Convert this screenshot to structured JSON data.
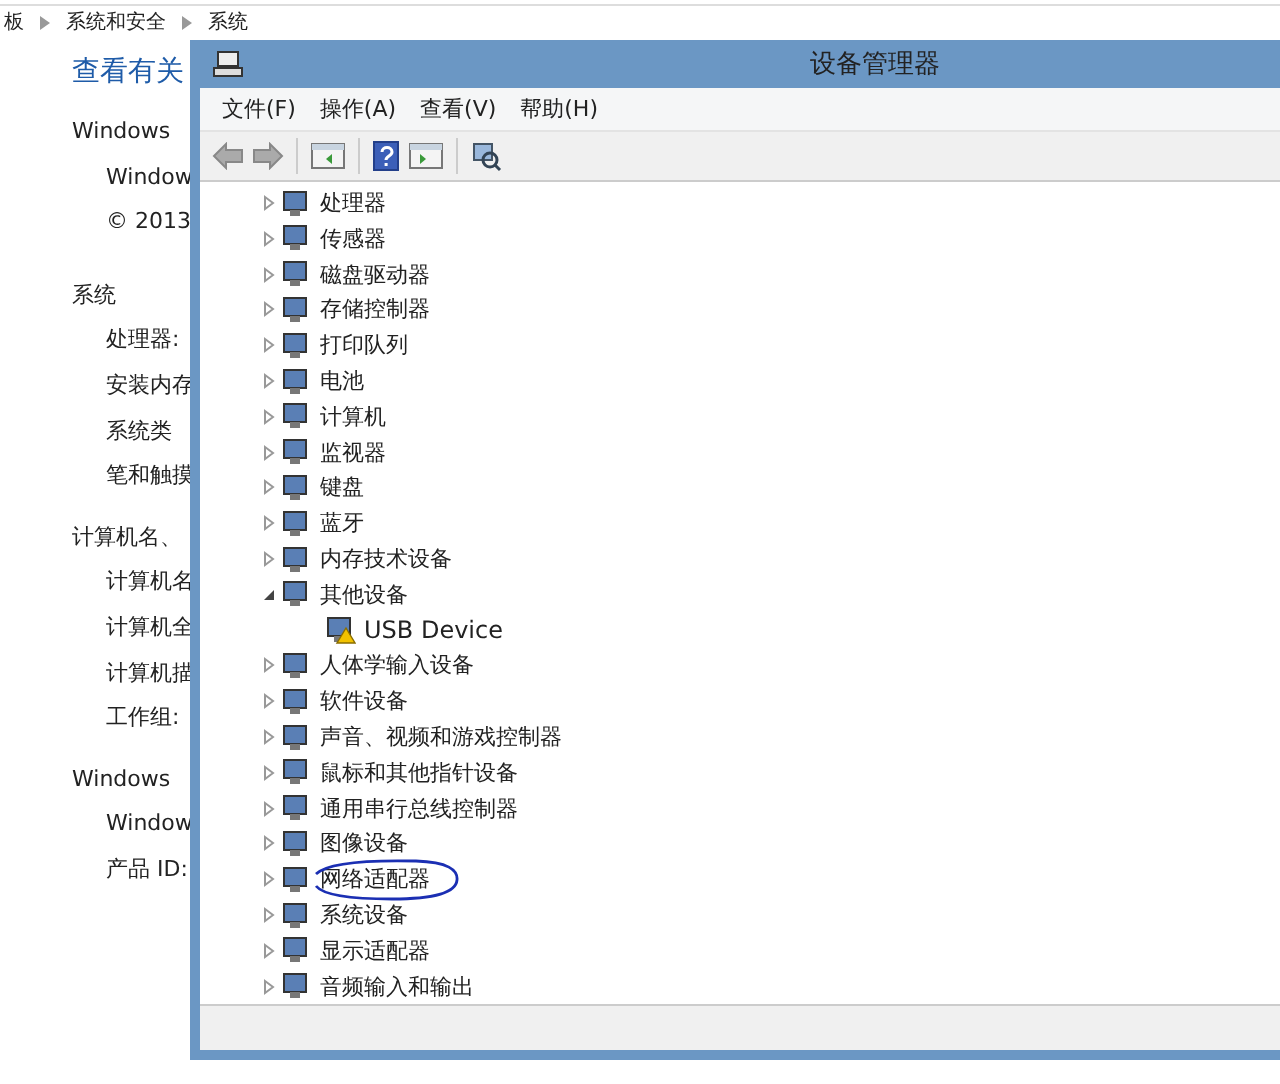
{
  "background_page": {
    "breadcrumb": [
      "板",
      "系统和安全",
      "系统"
    ],
    "heading": "查看有关",
    "lines": [
      {
        "text": "Windows",
        "kind": "section"
      },
      {
        "text": "Window",
        "kind": "item"
      },
      {
        "text": "© 2013",
        "kind": "item"
      },
      {
        "text": "系统",
        "kind": "group"
      },
      {
        "text": "处理器:",
        "kind": "item"
      },
      {
        "text": "安装内存",
        "kind": "item"
      },
      {
        "text": "系统类",
        "kind": "item"
      },
      {
        "text": "笔和触摸",
        "kind": "item"
      },
      {
        "text": "计算机名、",
        "kind": "section"
      },
      {
        "text": "计算机名",
        "kind": "item"
      },
      {
        "text": "计算机全",
        "kind": "item"
      },
      {
        "text": "计算机描",
        "kind": "item"
      },
      {
        "text": "工作组:",
        "kind": "item"
      },
      {
        "text": "Windows",
        "kind": "section"
      },
      {
        "text": "Window",
        "kind": "item"
      },
      {
        "text": "产品 ID:",
        "kind": "item"
      }
    ]
  },
  "window": {
    "title": "设备管理器",
    "menu": [
      "文件(F)",
      "操作(A)",
      "查看(V)",
      "帮助(H)"
    ],
    "tree": [
      {
        "label": "处理器",
        "expanded": false,
        "circled": false
      },
      {
        "label": "传感器",
        "expanded": false,
        "circled": false
      },
      {
        "label": "磁盘驱动器",
        "expanded": false,
        "circled": false
      },
      {
        "label": "存储控制器",
        "expanded": false,
        "circled": false
      },
      {
        "label": "打印队列",
        "expanded": false,
        "circled": false
      },
      {
        "label": "电池",
        "expanded": false,
        "circled": false
      },
      {
        "label": "计算机",
        "expanded": false,
        "circled": false
      },
      {
        "label": "监视器",
        "expanded": false,
        "circled": false
      },
      {
        "label": "键盘",
        "expanded": false,
        "circled": false
      },
      {
        "label": "蓝牙",
        "expanded": false,
        "circled": false
      },
      {
        "label": "内存技术设备",
        "expanded": false,
        "circled": false
      },
      {
        "label": "其他设备",
        "expanded": true,
        "circled": false,
        "children": [
          {
            "label": "USB Device",
            "warning": true,
            "circled": false
          }
        ]
      },
      {
        "label": "人体学输入设备",
        "expanded": false,
        "circled": false
      },
      {
        "label": "软件设备",
        "expanded": false,
        "circled": false
      },
      {
        "label": "声音、视频和游戏控制器",
        "expanded": false,
        "circled": false
      },
      {
        "label": "鼠标和其他指针设备",
        "expanded": false,
        "circled": false
      },
      {
        "label": "通用串行总线控制器",
        "expanded": false,
        "circled": false
      },
      {
        "label": "图像设备",
        "expanded": false,
        "circled": false
      },
      {
        "label": "网络适配器",
        "expanded": false,
        "circled": true
      },
      {
        "label": "系统设备",
        "expanded": false,
        "circled": false
      },
      {
        "label": "显示适配器",
        "expanded": false,
        "circled": false
      },
      {
        "label": "音频输入和输出",
        "expanded": false,
        "circled": false
      }
    ]
  }
}
